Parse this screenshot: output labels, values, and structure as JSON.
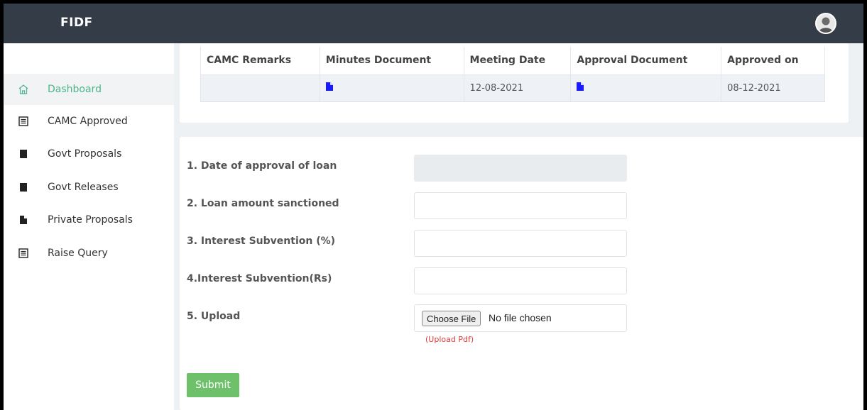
{
  "app": {
    "brand": "FIDF"
  },
  "sidebar": {
    "items": [
      {
        "label": "Dashboard",
        "icon": "home-icon",
        "active": true
      },
      {
        "label": "CAMC Approved",
        "icon": "list-icon"
      },
      {
        "label": "Govt Proposals",
        "icon": "book-icon"
      },
      {
        "label": "Govt Releases",
        "icon": "book-icon"
      },
      {
        "label": "Private Proposals",
        "icon": "file-icon"
      },
      {
        "label": "Raise Query",
        "icon": "list-icon"
      }
    ]
  },
  "table": {
    "headers": [
      "CAMC Remarks",
      "Minutes Document",
      "Meeting Date",
      "Approval Document",
      "Approved on"
    ],
    "row": {
      "camc_remarks": "",
      "minutes_document": "document-icon",
      "meeting_date": "12-08-2021",
      "approval_document": "document-icon",
      "approved_on": "08-12-2021"
    }
  },
  "form": {
    "fields": [
      {
        "label": "1. Date of approval of loan",
        "value": "",
        "disabled": true
      },
      {
        "label": "2. Loan amount sanctioned",
        "value": ""
      },
      {
        "label": "3. Interest Subvention (%)",
        "value": ""
      },
      {
        "label": "4.Interest Subvention(Rs)",
        "value": ""
      }
    ],
    "upload": {
      "label": "5. Upload",
      "button": "Choose File",
      "status": "No file chosen",
      "hint": "(Upload Pdf)"
    },
    "submit": "Submit"
  },
  "colors": {
    "topbar": "#343c47",
    "accent": "#4cb58a",
    "submit": "#6fc06a",
    "doc_icon": "#1a1aff",
    "hint": "#e03b3b"
  }
}
